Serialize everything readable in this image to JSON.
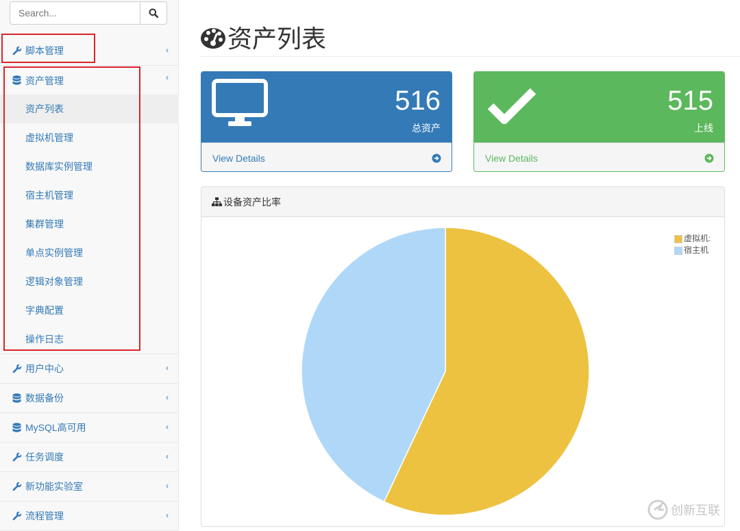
{
  "search": {
    "placeholder": "Search..."
  },
  "sidebar": {
    "items": [
      {
        "label": "脚本管理",
        "icon": "wrench-icon"
      },
      {
        "label": "资产管理",
        "icon": "database-icon"
      },
      {
        "label": "用户中心",
        "icon": "wrench-icon"
      },
      {
        "label": "数据备份",
        "icon": "database-icon"
      },
      {
        "label": "MySQL高可用",
        "icon": "database-icon"
      },
      {
        "label": "任务调度",
        "icon": "wrench-icon"
      },
      {
        "label": "新功能实验室",
        "icon": "wrench-icon"
      },
      {
        "label": "流程管理",
        "icon": "wrench-icon"
      }
    ],
    "submenu": [
      "资产列表",
      "虚拟机管理",
      "数据库实例管理",
      "宿主机管理",
      "集群管理",
      "单点实例管理",
      "逻辑对象管理",
      "字典配置",
      "操作日志"
    ],
    "active_submenu": "资产列表"
  },
  "page": {
    "title": "资产列表"
  },
  "stats": [
    {
      "value": "516",
      "label": "总资产",
      "link": "View Details",
      "color": "#337ab7",
      "icon": "desktop-icon"
    },
    {
      "value": "515",
      "label": "上线",
      "link": "View Details",
      "color": "#5cb85c",
      "icon": "check-icon"
    }
  ],
  "chart_panel": {
    "title": "设备资产比率"
  },
  "chart_data": {
    "type": "pie",
    "series": [
      {
        "name": "虚拟机",
        "value": 57,
        "color": "#edc240"
      },
      {
        "name": "宿主机",
        "value": 43,
        "color": "#afd8f8"
      }
    ],
    "legend": {
      "labels": [
        "虚拟机:",
        "宿主机"
      ],
      "position": "top-right"
    }
  },
  "watermark": {
    "text": "创新互联"
  }
}
